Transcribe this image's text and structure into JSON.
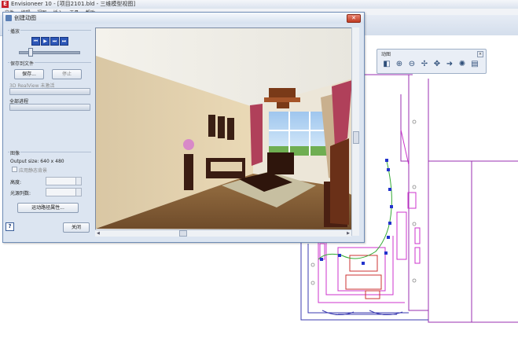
{
  "app": {
    "title": "Envisioneer 10 - [项目2101.bld - 三维模型视图]",
    "icon_letter": "E",
    "menu": [
      "文件",
      "编辑",
      "视图",
      "插入",
      "工具",
      "帮助"
    ]
  },
  "view_toolbar": {
    "title": "动图",
    "close": "×",
    "icons": [
      "camera-icon",
      "zoom-in-icon",
      "zoom-out-icon",
      "walk-icon",
      "pan-icon",
      "arrow-icon",
      "render-icon",
      "settings-icon"
    ]
  },
  "dialog": {
    "title": "创建动图",
    "close": "✕",
    "playback_label": "播放",
    "playback_buttons": [
      "⏮",
      "▶",
      "⏭",
      "⏭"
    ],
    "save_section": {
      "label": "保存到文件",
      "save_button": "保存...",
      "stop_button": "停止",
      "realview_status": "3D RealView 未激活",
      "full_progress_label": "全部进程"
    },
    "settings": {
      "label": "图像",
      "output_size": "Output size: 640 x 480",
      "static_bg_label": "应用静态背景",
      "height_label": "高度:",
      "lights_label": "光源列数:",
      "anim_props_button": "运动路径属性...",
      "close_button": "关闭"
    },
    "help": "?"
  },
  "colors": {
    "dialog_bg": "#dce5f1",
    "accent": "#2d57b8",
    "plan_magenta": "#cc33cc",
    "plan_blue": "#2233cc",
    "plan_green": "#33aa33"
  }
}
